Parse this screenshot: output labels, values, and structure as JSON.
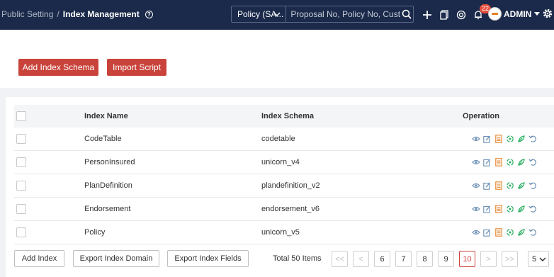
{
  "header": {
    "breadcrumb": {
      "parent": "Public Setting",
      "separator": "/",
      "current": "Index Management"
    },
    "search": {
      "type_value": "Policy (SA...",
      "placeholder": "Proposal No, Policy No, Cust"
    },
    "notification_count": "22",
    "user_name": "ADMIN"
  },
  "toolbar": {
    "add_schema_label": "Add Index Schema",
    "import_script_label": "Import Script"
  },
  "table": {
    "columns": [
      "Index Name",
      "Index Schema",
      "Operation"
    ],
    "rows": [
      {
        "name": "CodeTable",
        "schema": "codetable"
      },
      {
        "name": "PersonInsured",
        "schema": "unicorn_v4"
      },
      {
        "name": "PlanDefinition",
        "schema": "plandefinition_v2"
      },
      {
        "name": "Endorsement",
        "schema": "endorsement_v6"
      },
      {
        "name": "Policy",
        "schema": "unicorn_v5"
      }
    ]
  },
  "footer": {
    "add_index_label": "Add Index",
    "export_domain_label": "Export Index Domain",
    "export_fields_label": "Export Index Fields",
    "total_text": "Total 50 Items",
    "pager": {
      "first": "<<",
      "prev": "<",
      "pages": [
        "6",
        "7",
        "8",
        "9",
        "10"
      ],
      "current": "10",
      "next": ">",
      "last": ">>"
    },
    "page_size": "5"
  },
  "colors": {
    "header_bg": "#1b2a4a",
    "accent_red": "#c9433b",
    "icon_blue": "#6c8fb3",
    "icon_orange": "#e67e22",
    "icon_green": "#27ae60"
  }
}
